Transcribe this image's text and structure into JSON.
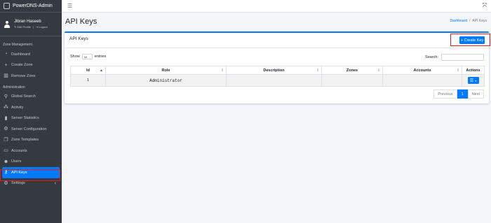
{
  "app": {
    "title": "PowerDNS-Admin"
  },
  "user": {
    "name": "Jibran Haseeb",
    "edit_profile": "Edit Profile",
    "logout": "Logout"
  },
  "sidebar": {
    "section_zone": "Zone Management",
    "section_admin": "Administration",
    "zone_items": [
      {
        "label": "Dashboard",
        "icon": "dashboard-icon"
      },
      {
        "label": "Create Zone",
        "icon": "plus-icon"
      },
      {
        "label": "Remove Zone",
        "icon": "trash-icon"
      }
    ],
    "admin_items": [
      {
        "label": "Global Search",
        "icon": "search-icon"
      },
      {
        "label": "Activity",
        "icon": "activity-icon"
      },
      {
        "label": "Server Statistics",
        "icon": "bar-chart-icon"
      },
      {
        "label": "Server Configuration",
        "icon": "gear-icon"
      },
      {
        "label": "Zone Templates",
        "icon": "copy-icon"
      },
      {
        "label": "Accounts",
        "icon": "id-card-icon"
      },
      {
        "label": "Users",
        "icon": "users-icon"
      },
      {
        "label": "API Keys",
        "icon": "key-icon"
      },
      {
        "label": "Settings",
        "icon": "gear-icon"
      }
    ]
  },
  "header": {
    "title": "API Keys"
  },
  "breadcrumb": {
    "home": "Dashboard",
    "sep": "/",
    "current": "API Keys"
  },
  "card": {
    "title": "API Keys",
    "create_button": "+ Create Key",
    "show_label": "Show",
    "entries_value": "10",
    "entries_label": "entries",
    "search_label": "Search:"
  },
  "table": {
    "columns": [
      "Id",
      "Role",
      "Description",
      "Zones",
      "Accounts",
      "Actions"
    ],
    "rows": [
      {
        "id": "1",
        "role": "Administrator",
        "description": "",
        "zones": "",
        "accounts": ""
      }
    ]
  },
  "pagination": {
    "previous": "Previous",
    "page": "1",
    "next": "Next"
  },
  "colors": {
    "primary": "#007bff",
    "sidebar_bg": "#343a40",
    "highlight_outline": "#e02020"
  }
}
